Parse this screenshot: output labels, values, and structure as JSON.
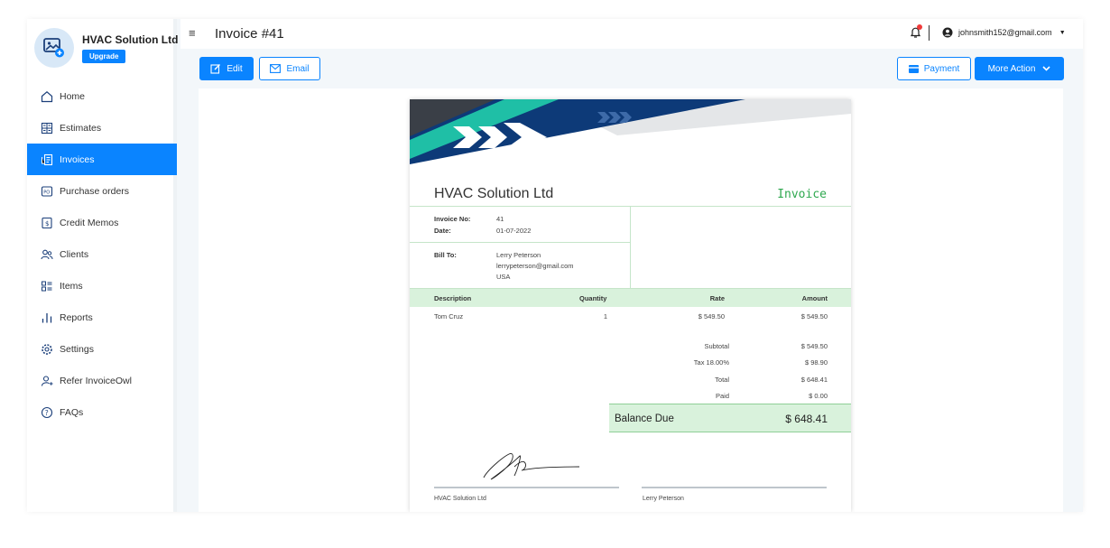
{
  "brand": {
    "name": "HVAC Solution Ltd",
    "upgrade_label": "Upgrade"
  },
  "nav": {
    "items": [
      {
        "label": "Home",
        "icon": "home-icon"
      },
      {
        "label": "Estimates",
        "icon": "estimates-icon"
      },
      {
        "label": "Invoices",
        "icon": "invoices-icon",
        "active": true
      },
      {
        "label": "Purchase orders",
        "icon": "purchase-orders-icon"
      },
      {
        "label": "Credit Memos",
        "icon": "credit-memos-icon"
      },
      {
        "label": "Clients",
        "icon": "clients-icon"
      },
      {
        "label": "Items",
        "icon": "items-icon"
      },
      {
        "label": "Reports",
        "icon": "reports-icon"
      },
      {
        "label": "Settings",
        "icon": "settings-icon"
      },
      {
        "label": "Refer InvoiceOwl",
        "icon": "refer-icon"
      },
      {
        "label": "FAQs",
        "icon": "faq-icon"
      }
    ]
  },
  "header": {
    "menu_icon": "≡",
    "title": "Invoice #41",
    "user_email": "johnsmith152@gmail.com"
  },
  "toolbar": {
    "edit_label": "Edit",
    "email_label": "Email",
    "payment_label": "Payment",
    "more_label": "More Action"
  },
  "invoice": {
    "company": "HVAC Solution Ltd",
    "doc_label": "Invoice",
    "invoice_no_label": "Invoice No:",
    "invoice_no": "41",
    "date_label": "Date:",
    "date": "01-07-2022",
    "bill_to_label": "Bill To:",
    "bill_to_name": "Lerry Peterson",
    "bill_to_email": "lerrypeterson@gmail.com",
    "bill_to_country": "USA",
    "columns": {
      "description": "Description",
      "quantity": "Quantity",
      "rate": "Rate",
      "amount": "Amount"
    },
    "items": [
      {
        "description": "Tom Cruz",
        "quantity": "1",
        "rate": "$ 549.50",
        "amount": "$ 549.50"
      }
    ],
    "totals": [
      {
        "label": "Subtotal",
        "value": "$ 549.50"
      },
      {
        "label": "Tax 18.00%",
        "value": "$ 98.90"
      },
      {
        "label": "Total",
        "value": "$ 648.41"
      },
      {
        "label": "Paid",
        "value": "$ 0.00"
      }
    ],
    "balance_label": "Balance Due",
    "balance_value": "$ 648.41",
    "signer_left": "HVAC Solution Ltd",
    "signer_right": "Lerry Peterson"
  },
  "colors": {
    "accent": "#0a84ff",
    "invoice_green": "#2fa84f",
    "table_header_bg": "#d9f2dc",
    "banner_navy": "#0d3a78",
    "banner_teal": "#1fbfa6",
    "banner_dark": "#3a3f47"
  }
}
